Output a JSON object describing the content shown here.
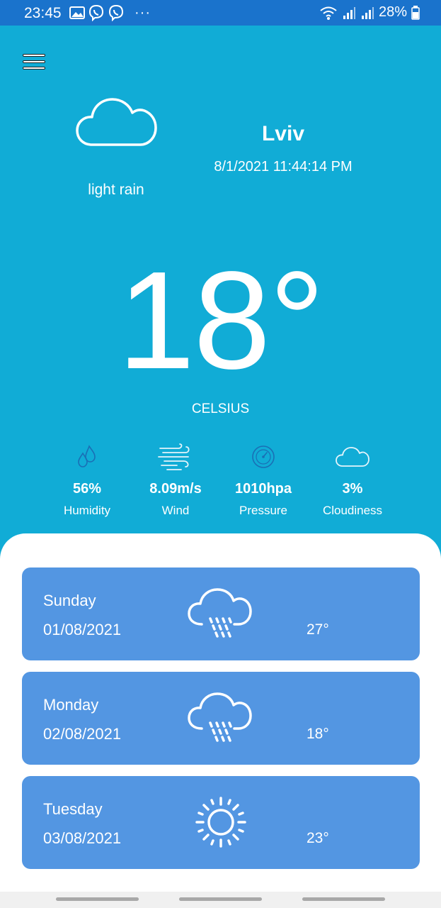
{
  "status_bar": {
    "time": "23:45",
    "left_icons": [
      "gallery-icon",
      "viber-icon",
      "viber-icon",
      "more-icon"
    ],
    "more": "···",
    "battery": "28%"
  },
  "current": {
    "condition": "light rain",
    "city": "Lviv",
    "datetime": "8/1/2021 11:44:14 PM",
    "temperature": "18°",
    "unit": "CELSIUS"
  },
  "stats": [
    {
      "icon": "humidity-icon",
      "value": "56%",
      "label": "Humidity"
    },
    {
      "icon": "wind-icon",
      "value": "8.09m/s",
      "label": "Wind"
    },
    {
      "icon": "pressure-icon",
      "value": "1010hpa",
      "label": "Pressure"
    },
    {
      "icon": "cloudiness-icon",
      "value": "3%",
      "label": "Cloudiness"
    }
  ],
  "forecast": [
    {
      "day": "Sunday",
      "date": "01/08/2021",
      "icon": "rain-cloud-icon",
      "temp": "27°"
    },
    {
      "day": "Monday",
      "date": "02/08/2021",
      "icon": "rain-cloud-icon",
      "temp": "18°"
    },
    {
      "day": "Tuesday",
      "date": "03/08/2021",
      "icon": "sun-icon",
      "temp": "23°"
    }
  ],
  "colors": {
    "status_bar": "#1a73cc",
    "hero_background": "#11acd6",
    "card_background": "#5396e2",
    "stat_icon": "#1a6fb5"
  }
}
